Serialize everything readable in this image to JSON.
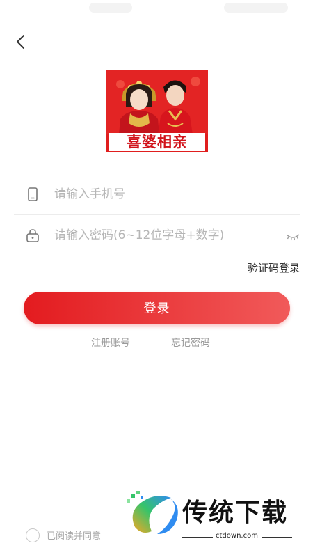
{
  "colors": {
    "brand": "#e31b1f",
    "placeholder": "#b6b6b6",
    "link_gray": "#9a9a9a"
  },
  "icons": {
    "back": "chevron-left-icon",
    "phone": "phone-icon",
    "lock": "lock-icon",
    "eye": "eye-closed-icon",
    "radio": "radio-unchecked-icon"
  },
  "logo": {
    "title": "喜婆相亲"
  },
  "form": {
    "phone_placeholder": "请输入手机号",
    "password_placeholder": "请输入密码(6~12位字母+数字)"
  },
  "sms_login_label": "验证码登录",
  "login_label": "登录",
  "links": {
    "register": "注册账号",
    "forgot": "忘记密码"
  },
  "agreement": {
    "text": "已阅读并同意"
  },
  "watermark": {
    "brand": "传统下载",
    "url": "ctdown.com"
  }
}
